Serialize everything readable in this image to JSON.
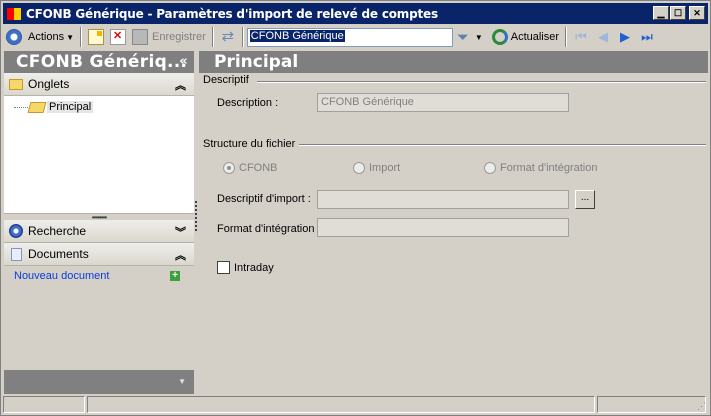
{
  "window": {
    "title": "CFONB Générique - Paramètres d'import de relevé de comptes",
    "min_btn": "▁",
    "max_btn": "☐",
    "close_btn": "✕"
  },
  "toolbar": {
    "actions_label": "Actions",
    "save_label": "Enregistrer",
    "search_value": "CFONB Générique",
    "refresh_label": "Actualiser"
  },
  "left_pane": {
    "title": "CFONB Génériq...",
    "collapse_glyph": "«",
    "onglets": {
      "label": "Onglets",
      "items": [
        {
          "label": "Principal"
        }
      ]
    },
    "recherche": {
      "label": "Recherche"
    },
    "documents": {
      "label": "Documents",
      "new_document": "Nouveau document"
    }
  },
  "main": {
    "title": "Principal",
    "descriptif": {
      "title": "Descriptif",
      "description_label": "Description :",
      "description_value": "CFONB Générique"
    },
    "structure": {
      "title": "Structure du fichier",
      "radios": [
        {
          "label": "CFONB",
          "selected": true
        },
        {
          "label": "Import",
          "selected": false
        },
        {
          "label": "Format d'intégration",
          "selected": false
        }
      ],
      "descriptif_import_label": "Descriptif d'import :",
      "descriptif_import_value": "",
      "browse_label": "...",
      "format_integration_label": "Format d'intégration :",
      "format_integration_value": ""
    },
    "intraday": {
      "label": "Intraday",
      "checked": false
    }
  },
  "colors": {
    "titlebar": "#0a246a",
    "pane_header": "#7f7f7f",
    "link": "#0a3cd8"
  }
}
